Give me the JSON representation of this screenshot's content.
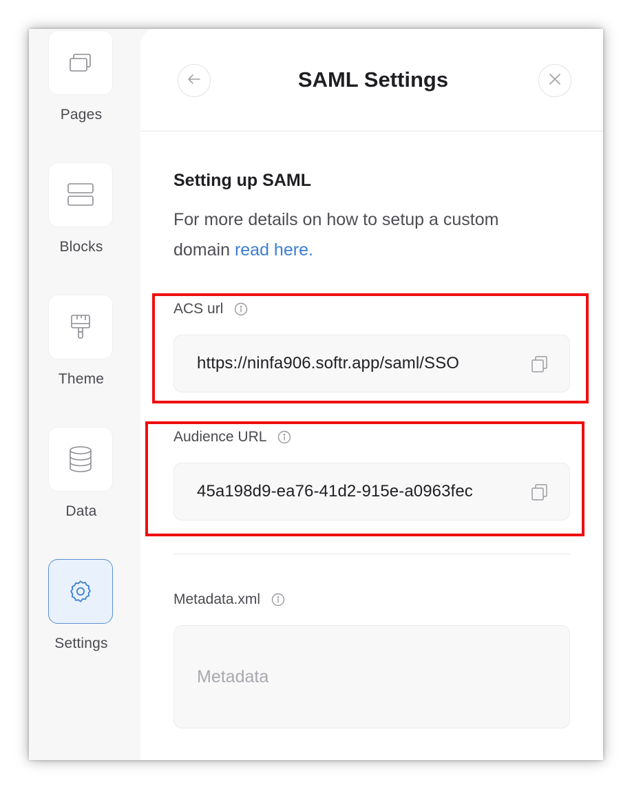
{
  "sidebar": {
    "items": [
      {
        "label": "Pages",
        "icon": "pages-icon",
        "active": false
      },
      {
        "label": "Blocks",
        "icon": "blocks-icon",
        "active": false
      },
      {
        "label": "Theme",
        "icon": "theme-icon",
        "active": false
      },
      {
        "label": "Data",
        "icon": "database-icon",
        "active": false
      },
      {
        "label": "Settings",
        "icon": "gear-icon",
        "active": true
      }
    ]
  },
  "panel": {
    "title": "SAML Settings",
    "section_title": "Setting up SAML",
    "description": "For more details on how to setup a custom domain ",
    "link_text": "read here."
  },
  "fields": {
    "acs": {
      "label": "ACS url",
      "value": "https://ninfa906.softr.app/saml/SSO"
    },
    "audience": {
      "label": "Audience URL",
      "value": "45a198d9-ea76-41d2-915e-a0963fec"
    },
    "metadata": {
      "label": "Metadata.xml",
      "placeholder": "Metadata"
    }
  },
  "colors": {
    "accent": "#3b7fd0",
    "active_tile": "#e9f1fc",
    "highlight": "#ef0f0f"
  }
}
